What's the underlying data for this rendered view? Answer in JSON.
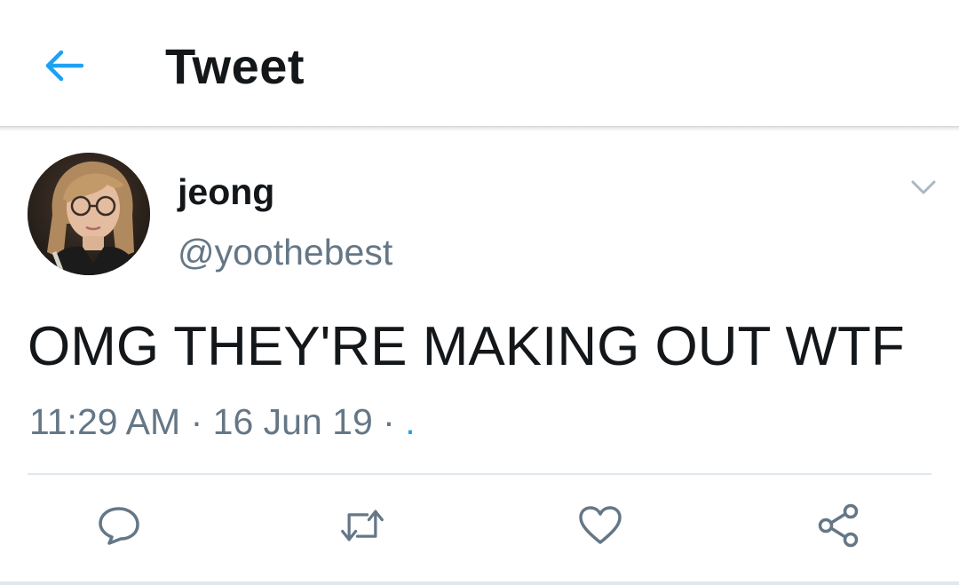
{
  "header": {
    "title": "Tweet",
    "back_icon": "back-arrow-icon"
  },
  "tweet": {
    "display_name": "jeong",
    "handle": "@yoothebest",
    "text": "OMG THEY'RE MAKING OUT WTF",
    "time": "11:29 AM",
    "separator": "·",
    "date": "16 Jun 19",
    "trailing": ".",
    "menu_icon": "chevron-down-icon"
  },
  "actions": [
    {
      "name": "reply",
      "icon": "reply-icon"
    },
    {
      "name": "retweet",
      "icon": "retweet-icon"
    },
    {
      "name": "like",
      "icon": "heart-icon"
    },
    {
      "name": "share",
      "icon": "share-icon"
    }
  ],
  "colors": {
    "accent": "#1da1f2",
    "text": "#14171a",
    "secondary": "#657786",
    "divider": "#e1e8ed"
  }
}
